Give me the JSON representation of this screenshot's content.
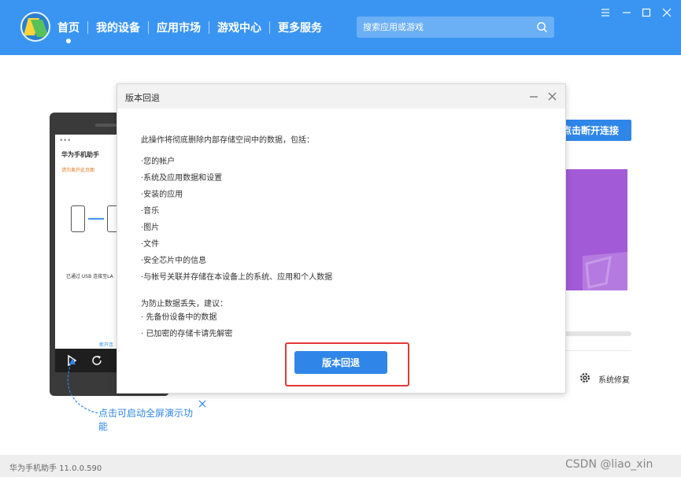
{
  "app": {
    "version_label": "华为手机助手 11.0.0.590"
  },
  "nav": {
    "items": [
      {
        "label": "首页"
      },
      {
        "label": "我的设备"
      },
      {
        "label": "应用市场"
      },
      {
        "label": "游戏中心"
      },
      {
        "label": "更多服务"
      }
    ],
    "active_index": 0
  },
  "search": {
    "placeholder": "搜索应用或游戏"
  },
  "window_controls": [
    "menu-icon",
    "minimize-icon",
    "maximize-icon",
    "close-icon"
  ],
  "background": {
    "phone": {
      "title": "华为手机助手",
      "notice": "请勿离开此页面",
      "usb_text": "已通过 USB 连接至LA",
      "break_text": "断开连"
    },
    "disconnect_button": "点击断开连接",
    "system_repair": "系统修复",
    "demo_hint": "点击可启动全屏演示功能"
  },
  "dialog": {
    "title": "版本回退",
    "intro": "此操作将彻底删除内部存储空间中的数据，包括：",
    "items": [
      "·您的帐户",
      "·系统及应用数据和设置",
      "·安装的应用",
      "·音乐",
      "·图片",
      "·文件",
      "·安全芯片中的信息",
      "·与帐号关联并存储在本设备上的系统、应用和个人数据"
    ],
    "advice_title": "为防止数据丢失，建议：",
    "advice_items": [
      "· 先备份设备中的数据",
      "· 已加密的存储卡请先解密"
    ],
    "confirm_button": "版本回退"
  },
  "watermark": "CSDN @liao_xin",
  "colors": {
    "topbar": "#3a95f2",
    "primary_button": "#2f86e8",
    "highlight": "#e53935",
    "purple_card": "#a25ad7"
  }
}
